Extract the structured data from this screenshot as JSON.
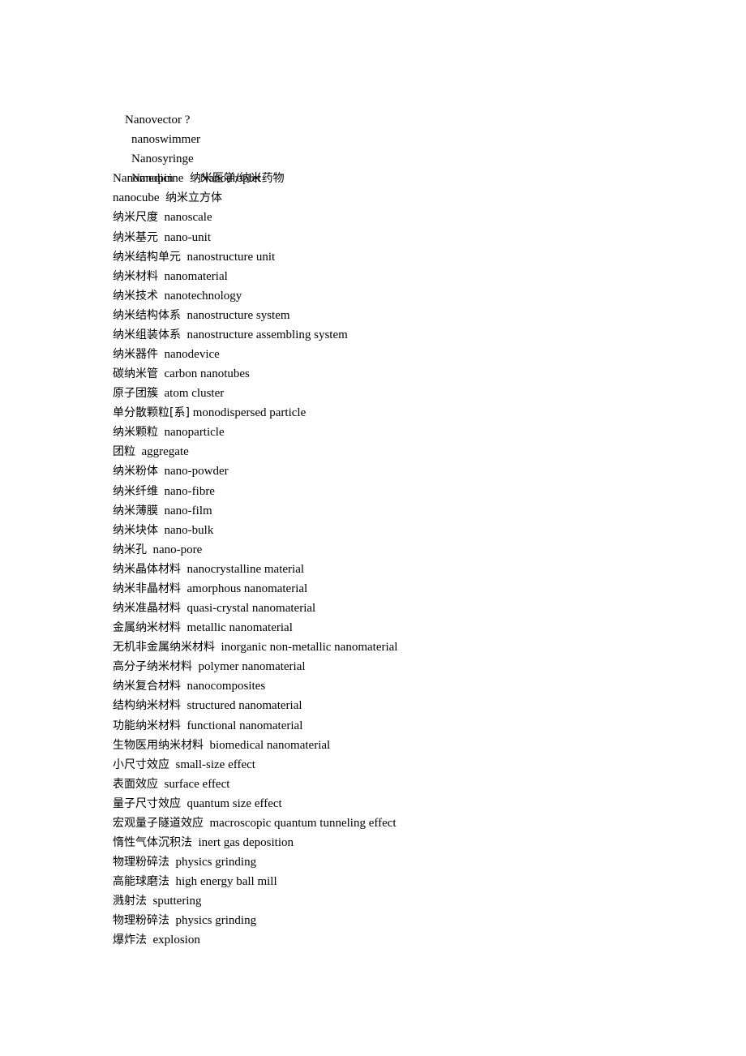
{
  "document": {
    "header_lines": [
      {
        "text": "Nanovector ?"
      },
      {
        "text": "nanoswimmer"
      },
      {
        "text": "Nanosyringe"
      },
      {
        "text_a": "Nanopin",
        "text_b": "Nanodroplet"
      }
    ],
    "entries": [
      {
        "en": "Nanomedicine",
        "zh": "纳米医学/纳米药物",
        "order": "en-zh"
      },
      {
        "en": "nanocube",
        "zh": "纳米立方体",
        "order": "en-zh"
      },
      {
        "zh": "纳米尺度",
        "en": "nanoscale"
      },
      {
        "zh": "纳米基元",
        "en": "nano-unit"
      },
      {
        "zh": "纳米结构单元",
        "en": "nanostructure unit"
      },
      {
        "zh": "纳米材料",
        "en": "nanomaterial"
      },
      {
        "zh": "纳米技术",
        "en": "nanotechnology"
      },
      {
        "zh": "纳米结构体系",
        "en": "nanostructure system"
      },
      {
        "zh": "纳米组装体系",
        "en": "nanostructure assembling system"
      },
      {
        "zh": "纳米器件",
        "en": "nanodevice"
      },
      {
        "zh": "碳纳米管",
        "en": "carbon nanotubes"
      },
      {
        "zh": "原子团簇",
        "en": "atom cluster"
      },
      {
        "zh": "单分散颗粒[系]",
        "en": "monodispersed particle"
      },
      {
        "zh": "纳米颗粒",
        "en": "nanoparticle"
      },
      {
        "zh": "团粒",
        "en": "aggregate"
      },
      {
        "zh": "纳米粉体",
        "en": "nano-powder"
      },
      {
        "zh": "纳米纤维",
        "en": "nano-fibre"
      },
      {
        "zh": "纳米薄膜",
        "en": "nano-film"
      },
      {
        "zh": "纳米块体",
        "en": "nano-bulk"
      },
      {
        "zh": "纳米孔",
        "en": "nano-pore"
      },
      {
        "zh": "纳米晶体材料",
        "en": "nanocrystalline material"
      },
      {
        "zh": "纳米非晶材料",
        "en": "amorphous nanomaterial"
      },
      {
        "zh": "纳米准晶材料",
        "en": "quasi-crystal nanomaterial"
      },
      {
        "zh": "金属纳米材料",
        "en": "metallic nanomaterial"
      },
      {
        "zh": "无机非金属纳米材料",
        "en": "inorganic non-metallic nanomaterial"
      },
      {
        "zh": "高分子纳米材料",
        "en": "polymer nanomaterial"
      },
      {
        "zh": "纳米复合材料",
        "en": "nanocomposites"
      },
      {
        "zh": "结构纳米材料",
        "en": "structured nanomaterial"
      },
      {
        "zh": "功能纳米材料",
        "en": "functional nanomaterial"
      },
      {
        "zh": "生物医用纳米材料",
        "en": "biomedical nanomaterial"
      },
      {
        "zh": "小尺寸效应",
        "en": "small-size effect"
      },
      {
        "zh": "表面效应",
        "en": "surface effect"
      },
      {
        "zh": "量子尺寸效应",
        "en": "quantum size effect"
      },
      {
        "zh": "宏观量子隧道效应",
        "en": "macroscopic quantum tunneling effect"
      },
      {
        "zh": "惰性气体沉积法",
        "en": "inert gas deposition"
      },
      {
        "zh": "物理粉碎法",
        "en": "physics grinding"
      },
      {
        "zh": "高能球磨法",
        "en": "high energy ball mill"
      },
      {
        "zh": "溅射法",
        "en": "sputtering"
      },
      {
        "zh": "物理粉碎法",
        "en": "physics grinding"
      },
      {
        "zh": "爆炸法",
        "en": "explosion"
      }
    ]
  }
}
